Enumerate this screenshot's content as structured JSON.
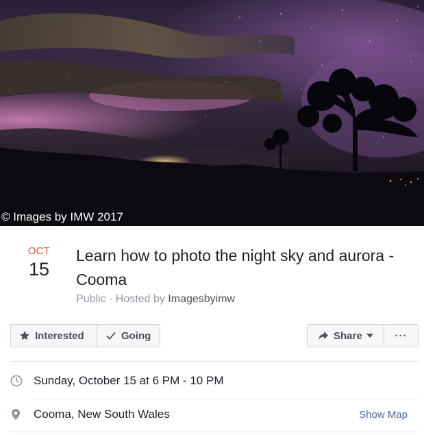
{
  "cover": {
    "watermark": "© Images by IMW 2017"
  },
  "event": {
    "month": "OCT",
    "day": "15",
    "title": "Learn how to photo the night sky and aurora - Cooma",
    "privacy": "Public",
    "separator": " · ",
    "hosted_by_prefix": "Hosted by ",
    "host": "Imagesbyimw"
  },
  "actions": {
    "interested_label": "Interested",
    "going_label": "Going",
    "share_label": "Share",
    "more_label": "···"
  },
  "details": {
    "datetime": "Sunday, October 15 at 6 PM - 10 PM",
    "location": "Cooma, New South Wales",
    "show_map_label": "Show Map"
  },
  "colors": {
    "month_accent": "#e9573f",
    "link": "#4b67a1",
    "muted": "#90949c"
  },
  "icons": {
    "interested": "star-icon",
    "going": "check-icon",
    "share": "share-arrow-icon",
    "dropdown": "caret-down-icon",
    "clock": "clock-icon",
    "location": "map-pin-icon"
  }
}
